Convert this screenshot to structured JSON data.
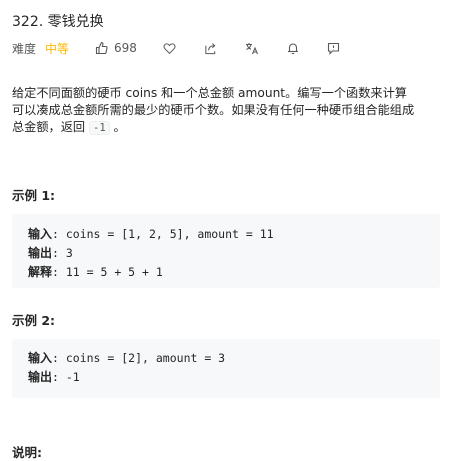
{
  "problem": {
    "number_title": "322. 零钱兑换",
    "difficulty_label": "难度",
    "difficulty": "中等",
    "likes": "698"
  },
  "colors": {
    "difficulty": "#ffb800",
    "icon": "#595959",
    "code_bg": "#f7f8fa"
  },
  "description": {
    "line1": "给定不同面额的硬币 coins 和一个总金额 amount。编写一个函数来计算",
    "line2": "可以凑成总金额所需的最少的硬币个数。如果没有任何一种硬币组合能组成",
    "line3_prefix": "总金额，返回 ",
    "line3_code": "-1",
    "line3_suffix": " 。"
  },
  "example1": {
    "heading": "示例 1:",
    "input_key": "输入",
    "input_val": ": coins = [1, 2, 5], amount = 11",
    "output_key": "输出",
    "output_val": ": 3",
    "explain_key": "解释",
    "explain_val": ": 11 = 5 + 5 + 1"
  },
  "example2": {
    "heading": "示例 2:",
    "input_key": "输入",
    "input_val": ": coins = [2], amount = 3",
    "output_key": "输出",
    "output_val": ": -1"
  },
  "notes": {
    "heading": "说明:"
  },
  "icons": [
    "thumbs-up-icon",
    "heart-icon",
    "share-icon",
    "translate-icon",
    "bell-icon",
    "comment-icon"
  ]
}
